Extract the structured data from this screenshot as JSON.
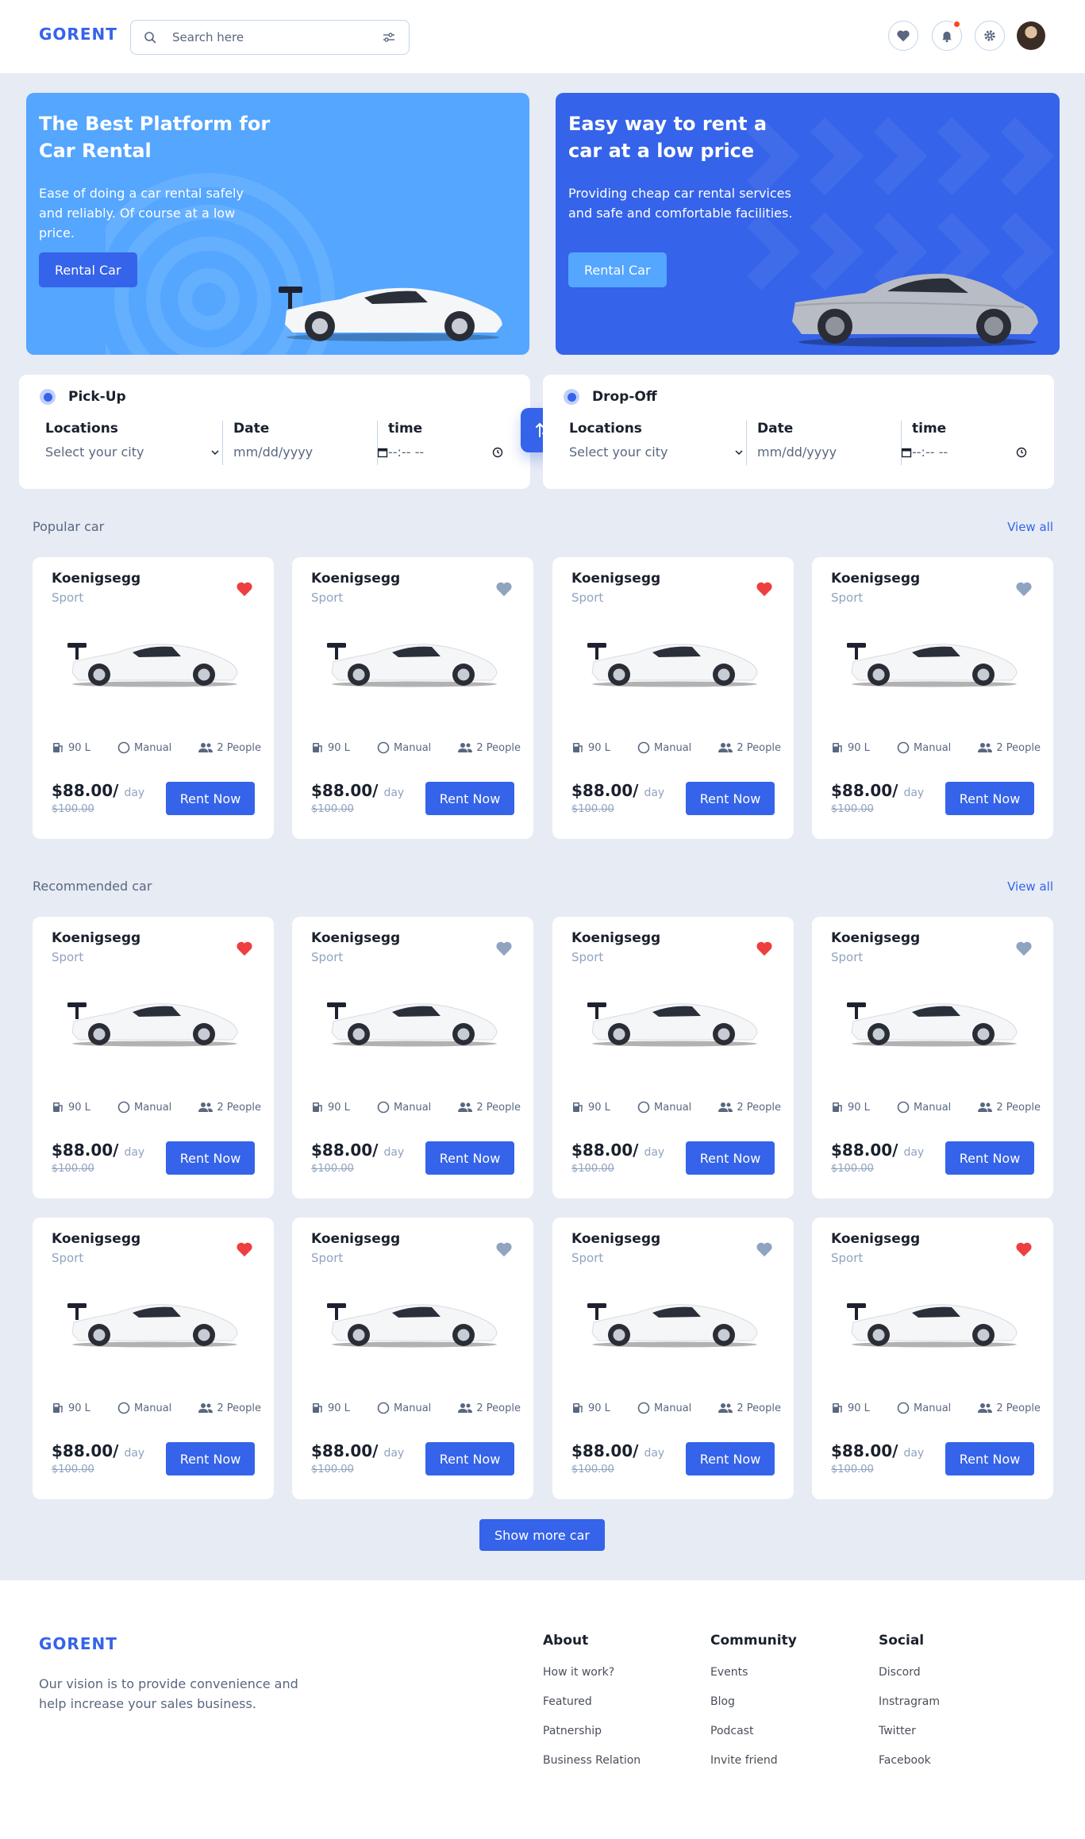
{
  "header": {
    "logo": "GORENT",
    "search_placeholder": "Search here"
  },
  "banners": [
    {
      "title": "The Best Platform for Car Rental",
      "text": "Ease of doing a car rental safely and reliably. Of course at a low price.",
      "button": "Rental Car",
      "color": "#54a6ff"
    },
    {
      "title": "Easy way to rent a car at a low price",
      "text": "Providing cheap car rental services and safe and comfortable facilities.",
      "button": "Rental Car",
      "color": "#3563e9"
    }
  ],
  "pickup": {
    "title": "Pick-Up",
    "locations_label": "Locations",
    "locations_value": "Select your city",
    "date_label": "Date",
    "date_value": "mm/dd/yyyy",
    "time_label": "time",
    "time_value": "--:-- --"
  },
  "dropoff": {
    "title": "Drop-Off",
    "locations_label": "Locations",
    "locations_value": "Select your city",
    "date_label": "Date",
    "date_value": "mm/dd/yyyy",
    "time_label": "time",
    "time_value": "--:-- --"
  },
  "popular": {
    "heading": "Popular car",
    "view_all": "View all",
    "cars": [
      {
        "name": "Koenigsegg",
        "type": "Sport",
        "fuel": "90 L",
        "transmission": "Manual",
        "capacity": "2 People",
        "price": "$88.00/",
        "per": "day",
        "old_price": "$100.00",
        "rent": "Rent Now",
        "liked": true
      },
      {
        "name": "Koenigsegg",
        "type": "Sport",
        "fuel": "90 L",
        "transmission": "Manual",
        "capacity": "2 People",
        "price": "$88.00/",
        "per": "day",
        "old_price": "$100.00",
        "rent": "Rent Now",
        "liked": false
      },
      {
        "name": "Koenigsegg",
        "type": "Sport",
        "fuel": "90 L",
        "transmission": "Manual",
        "capacity": "2 People",
        "price": "$88.00/",
        "per": "day",
        "old_price": "$100.00",
        "rent": "Rent Now",
        "liked": true
      },
      {
        "name": "Koenigsegg",
        "type": "Sport",
        "fuel": "90 L",
        "transmission": "Manual",
        "capacity": "2 People",
        "price": "$88.00/",
        "per": "day",
        "old_price": "$100.00",
        "rent": "Rent Now",
        "liked": false
      }
    ]
  },
  "recommended": {
    "heading": "Recommended car",
    "view_all": "View all",
    "cars": [
      {
        "name": "Koenigsegg",
        "type": "Sport",
        "fuel": "90 L",
        "transmission": "Manual",
        "capacity": "2 People",
        "price": "$88.00/",
        "per": "day",
        "old_price": "$100.00",
        "rent": "Rent Now",
        "liked": true
      },
      {
        "name": "Koenigsegg",
        "type": "Sport",
        "fuel": "90 L",
        "transmission": "Manual",
        "capacity": "2 People",
        "price": "$88.00/",
        "per": "day",
        "old_price": "$100.00",
        "rent": "Rent Now",
        "liked": false
      },
      {
        "name": "Koenigsegg",
        "type": "Sport",
        "fuel": "90 L",
        "transmission": "Manual",
        "capacity": "2 People",
        "price": "$88.00/",
        "per": "day",
        "old_price": "$100.00",
        "rent": "Rent Now",
        "liked": true
      },
      {
        "name": "Koenigsegg",
        "type": "Sport",
        "fuel": "90 L",
        "transmission": "Manual",
        "capacity": "2 People",
        "price": "$88.00/",
        "per": "day",
        "old_price": "$100.00",
        "rent": "Rent Now",
        "liked": false
      },
      {
        "name": "Koenigsegg",
        "type": "Sport",
        "fuel": "90 L",
        "transmission": "Manual",
        "capacity": "2 People",
        "price": "$88.00/",
        "per": "day",
        "old_price": "$100.00",
        "rent": "Rent Now",
        "liked": true
      },
      {
        "name": "Koenigsegg",
        "type": "Sport",
        "fuel": "90 L",
        "transmission": "Manual",
        "capacity": "2 People",
        "price": "$88.00/",
        "per": "day",
        "old_price": "$100.00",
        "rent": "Rent Now",
        "liked": false
      },
      {
        "name": "Koenigsegg",
        "type": "Sport",
        "fuel": "90 L",
        "transmission": "Manual",
        "capacity": "2 People",
        "price": "$88.00/",
        "per": "day",
        "old_price": "$100.00",
        "rent": "Rent Now",
        "liked": false
      },
      {
        "name": "Koenigsegg",
        "type": "Sport",
        "fuel": "90 L",
        "transmission": "Manual",
        "capacity": "2 People",
        "price": "$88.00/",
        "per": "day",
        "old_price": "$100.00",
        "rent": "Rent Now",
        "liked": true
      }
    ]
  },
  "show_more": "Show more car",
  "colors": {
    "accent": "#3563e9",
    "heart_active": "#ed3f3f",
    "heart_inactive": "#90a3bf",
    "background": "#e6ebf4"
  },
  "footer": {
    "logo": "GORENT",
    "vision": "Our vision is to provide convenience and help increase your sales business.",
    "columns": [
      {
        "title": "About",
        "items": [
          "How it work?",
          "Featured",
          "Patnership",
          "Business Relation"
        ]
      },
      {
        "title": "Community",
        "items": [
          "Events",
          "Blog",
          "Podcast",
          "Invite friend"
        ]
      },
      {
        "title": "Social",
        "items": [
          "Discord",
          "Instragram",
          "Twitter",
          "Facebook"
        ]
      }
    ]
  }
}
